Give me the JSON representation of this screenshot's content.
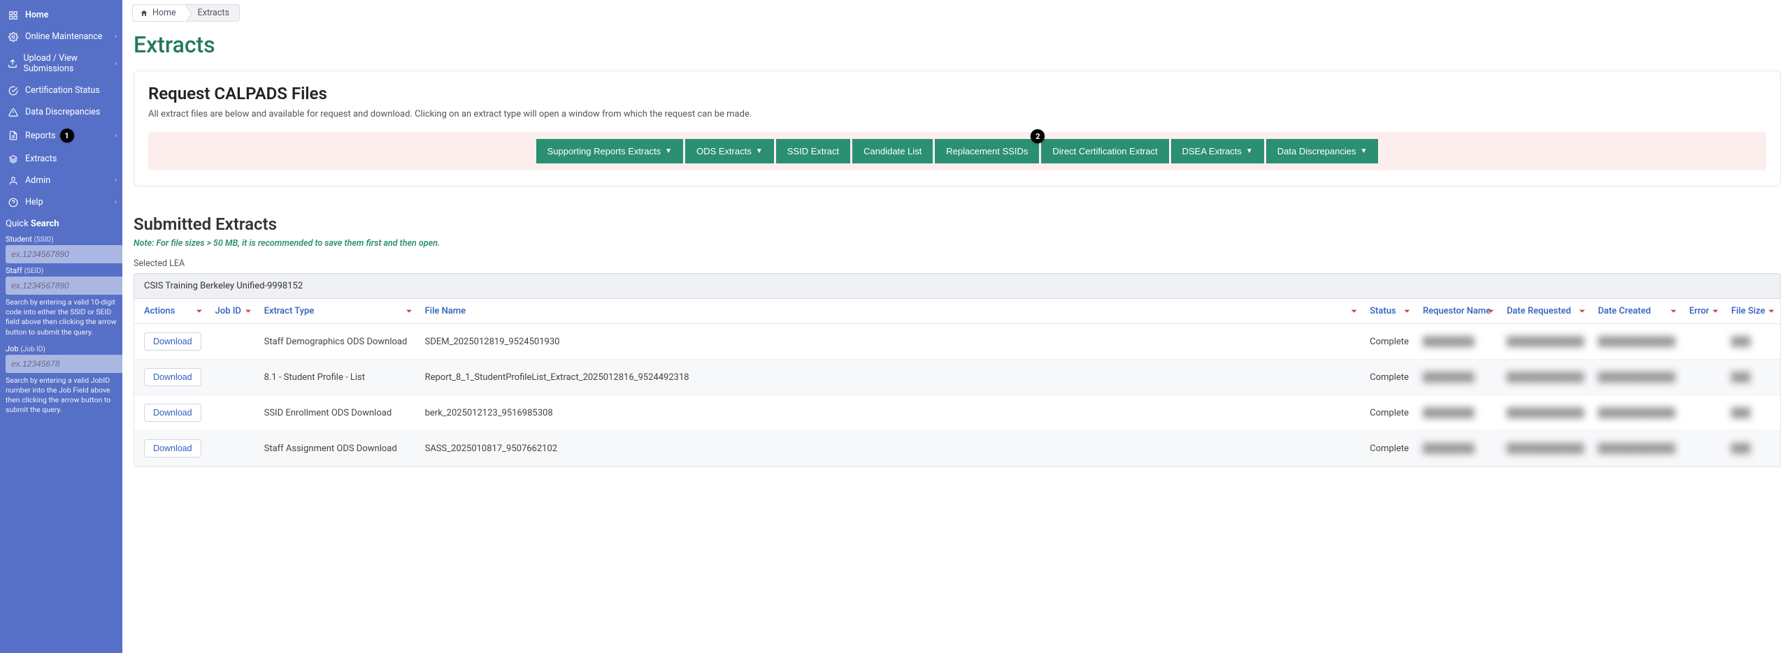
{
  "sidebar": {
    "items": [
      {
        "label": "Home",
        "icon": "grid",
        "chevron": false
      },
      {
        "label": "Online Maintenance",
        "icon": "gear",
        "chevron": true
      },
      {
        "label": "Upload / View Submissions",
        "icon": "upload",
        "chevron": true
      },
      {
        "label": "Certification Status",
        "icon": "check",
        "chevron": false
      },
      {
        "label": "Data Discrepancies",
        "icon": "warn",
        "chevron": false
      },
      {
        "label": "Reports",
        "icon": "doc",
        "chevron": true,
        "badge": "1"
      },
      {
        "label": "Extracts",
        "icon": "stack",
        "chevron": false,
        "active": true
      },
      {
        "label": "Admin",
        "icon": "user",
        "chevron": true
      },
      {
        "label": "Help",
        "icon": "help",
        "chevron": true
      }
    ],
    "quick_search": {
      "title_light": "Quick ",
      "title_bold": "Search",
      "student_label": "Student",
      "student_hint": "(SSID)",
      "student_placeholder": "ex.1234567890",
      "staff_label": "Staff",
      "staff_hint": "(SEID)",
      "staff_placeholder": "ex.1234567890",
      "help1": "Search by entering a valid 10-digit code into either the SSID or SEID field above then clicking the arrow button to submit the query.",
      "job_label": "Job",
      "job_hint": "(Job ID)",
      "job_placeholder": "ex.12345678",
      "help2": "Search by entering a valid JobID number into the Job Field above then clicking the arrow button to submit the query."
    }
  },
  "breadcrumbs": {
    "home": "Home",
    "current": "Extracts"
  },
  "page_title": "Extracts",
  "request_card": {
    "title": "Request CALPADS Files",
    "desc": "All extract files are below and available for request and download. Clicking on an extract type will open a window from which the request can be made.",
    "buttons": [
      {
        "label": "Supporting Reports Extracts",
        "caret": true
      },
      {
        "label": "ODS Extracts",
        "caret": true
      },
      {
        "label": "SSID Extract",
        "caret": false
      },
      {
        "label": "Candidate List",
        "caret": false
      },
      {
        "label": "Replacement SSIDs",
        "caret": false,
        "badge": "2"
      },
      {
        "label": "Direct Certification Extract",
        "caret": false
      },
      {
        "label": "DSEA Extracts",
        "caret": true
      },
      {
        "label": "Data Discrepancies",
        "caret": true
      }
    ]
  },
  "submitted": {
    "title": "Submitted Extracts",
    "note": "Note: For file sizes > 50 MB, it is recommended to save them first and then open.",
    "selected_lea_label": "Selected LEA",
    "selected_lea_value": "CSIS Training Berkeley Unified-9998152",
    "columns": [
      "Actions",
      "Job ID",
      "Extract Type",
      "File Name",
      "Status",
      "Requestor Name",
      "Date Requested",
      "Date Created",
      "Error",
      "File Size"
    ],
    "download_label": "Download",
    "rows": [
      {
        "extract_type": "Staff Demographics ODS Download",
        "file_name": "SDEM_2025012819_9524501930",
        "status": "Complete"
      },
      {
        "extract_type": "8.1 - Student Profile - List",
        "file_name": "Report_8_1_StudentProfileList_Extract_2025012816_9524492318",
        "status": "Complete"
      },
      {
        "extract_type": "SSID Enrollment ODS Download",
        "file_name": "berk_2025012123_9516985308",
        "status": "Complete"
      },
      {
        "extract_type": "Staff Assignment ODS Download",
        "file_name": "SASS_2025010817_9507662102",
        "status": "Complete"
      }
    ]
  }
}
